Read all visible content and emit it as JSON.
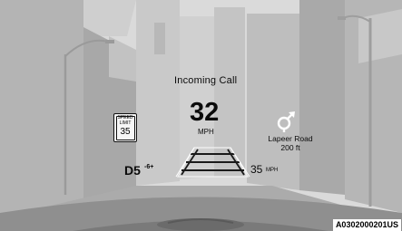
{
  "hud": {
    "notification": "Incoming Call",
    "speed": {
      "value": "32",
      "unit": "MPH"
    },
    "speed_limit_sign": {
      "line1": "SPEED",
      "line2": "LIMIT",
      "value": "35"
    },
    "navigation": {
      "road": "Lapeer Road",
      "distance": "200 ft",
      "icon": "turn-right-arrow-icon"
    },
    "gear": {
      "label": "D5",
      "superscript": "-6+"
    },
    "cruise_set_speed": {
      "value": "35",
      "unit": "MPH"
    }
  },
  "figure_id": "A0302000201US",
  "colors": {
    "sky": "#d8d8d8",
    "buildings": "#bfbfbf",
    "road": "#a9a9a9",
    "dashboard": "#8c8c8c",
    "hud_text": "#0a0a0a"
  }
}
